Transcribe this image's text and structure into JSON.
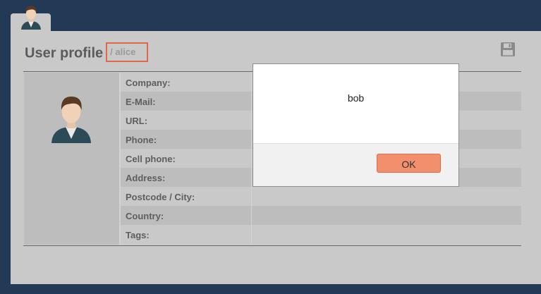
{
  "header": {
    "title": "User profile",
    "username": "/ alice"
  },
  "profile": {
    "fields": [
      {
        "label": "Company:"
      },
      {
        "label": "E-Mail:"
      },
      {
        "label": "URL:"
      },
      {
        "label": "Phone:"
      },
      {
        "label": "Cell phone:"
      },
      {
        "label": "Address:"
      },
      {
        "label": "Postcode / City:"
      },
      {
        "label": "Country:"
      },
      {
        "label": "Tags:"
      }
    ]
  },
  "dialog": {
    "message": "bob",
    "ok_label": "OK"
  },
  "colors": {
    "background": "#223a55",
    "panel": "#c9c9c9",
    "accent": "#f28f6d",
    "highlight_border": "#e2674a"
  },
  "icons": {
    "tab": "user-avatar-icon",
    "save": "floppy-disk-icon",
    "photo": "user-avatar-icon"
  }
}
